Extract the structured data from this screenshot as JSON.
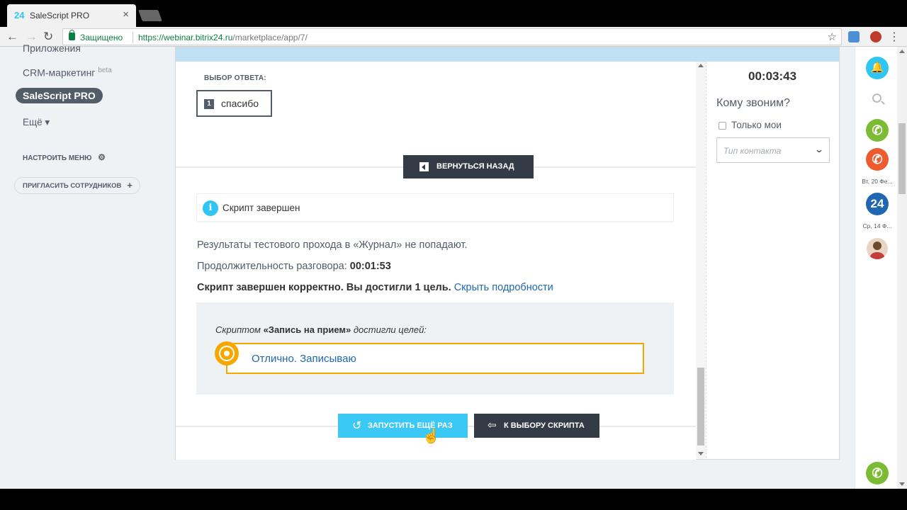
{
  "browser": {
    "tab_favicon": "24",
    "tab_title": "SaleScript PRO",
    "tab_close": "×",
    "secure_label": "Защищено",
    "url_scheme_host": "https://webinar.bitrix24.ru",
    "url_path": "/marketplace/app/7/",
    "back_icon": "←",
    "forward_icon": "→",
    "reload_icon": "↻",
    "star_icon": "☆",
    "menu_icon": "⋮"
  },
  "sidebar": {
    "cut_item": "Приложения",
    "crm_marketing": "CRM-маркетинг",
    "crm_badge": "beta",
    "active_item": "SaleScript PRO",
    "more": "Ещё ▾",
    "configure_menu": "НАСТРОИТЬ МЕНЮ",
    "configure_icon": "⚙",
    "invite": "ПРИГЛАСИТЬ СОТРУДНИКОВ",
    "invite_icon": "+"
  },
  "script": {
    "answer_heading": "ВЫБОР ОТВЕТА:",
    "answer_number": "1",
    "answer_text": "спасибо",
    "back_button": "ВЕРНУТЬСЯ НАЗАД",
    "notice_icon": "i",
    "notice_text": "Скрипт завершен",
    "result_line": "Результаты тестового прохода в «Журнал» не попадают.",
    "duration_label": "Продолжительность разговора: ",
    "duration_value": "00:01:53",
    "completed_text": "Скрипт завершен корректно. Вы достигли 1 цель.",
    "hide_details_link": "Скрыть подробности",
    "goals_heading_pre": "Скриптом ",
    "goals_heading_name": "«Запись на прием»",
    "goals_heading_post": " достигли целей:",
    "goal_text": "Отлично. Записываю",
    "run_again_button": "ЗАПУСТИТЬ ЕЩЁ РАЗ",
    "run_again_icon": "↺",
    "choose_script_button": "К ВЫБОРУ СКРИПТА",
    "choose_script_icon": "⇦"
  },
  "panel": {
    "timer": "00:03:43",
    "who_calling": "Кому звоним?",
    "only_mine": "Только мои",
    "contact_type_placeholder": "Тип контакта",
    "chevron": "⌄"
  },
  "rightbar": {
    "notifications_icon": "bell-icon",
    "call_green_icon": "phone-icon",
    "call_red_icon": "phone-icon",
    "date1": "Вт, 20 Фе...",
    "badge_24": "24",
    "date2": "Ср, 14 Ф...",
    "phone_bottom_icon": "phone-icon",
    "glyph_bell": "🔔",
    "glyph_phone": "✆"
  },
  "colors": {
    "accent_blue": "#2fc6f6",
    "dark_button": "#333c46",
    "goal_border": "#f7a700",
    "link": "#2067b0",
    "call_green": "#7cbb34",
    "call_red": "#ed5b2e",
    "badge_blue": "#2066b0"
  }
}
